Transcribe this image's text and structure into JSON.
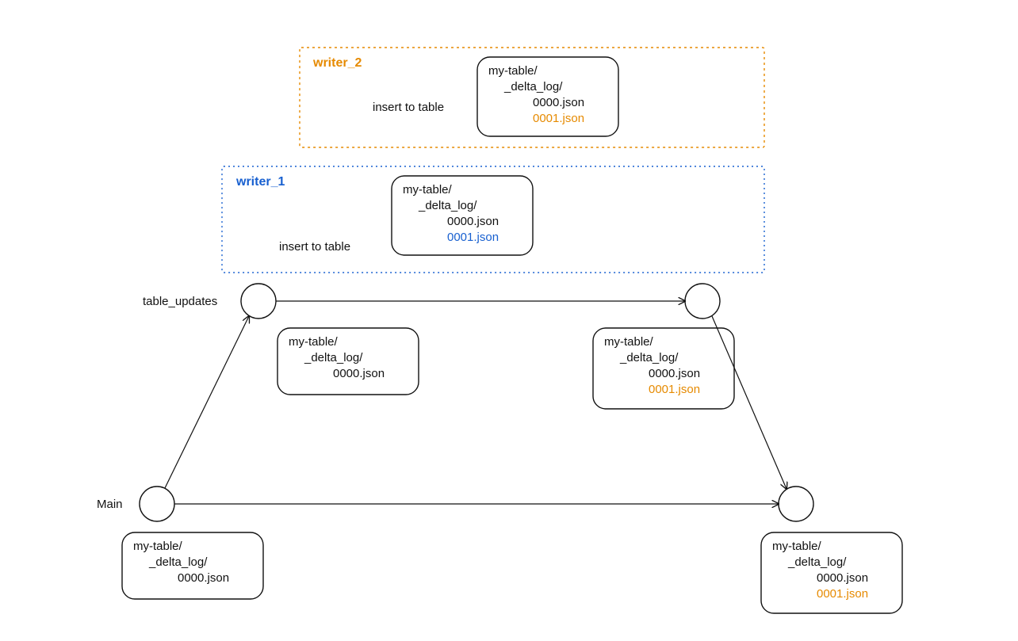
{
  "diagram": {
    "writer2": {
      "title": "writer_2",
      "action": "insert to table",
      "tree": {
        "root": "my-table/",
        "dir": "_delta_log/",
        "file0": "0000.json",
        "file1": "0001.json"
      }
    },
    "writer1": {
      "title": "writer_1",
      "action": "insert to table",
      "tree": {
        "root": "my-table/",
        "dir": "_delta_log/",
        "file0": "0000.json",
        "file1": "0001.json"
      }
    },
    "timeline": {
      "updates_label": "table_updates",
      "main_label": "Main",
      "state_left_updates": {
        "root": "my-table/",
        "dir": "_delta_log/",
        "file0": "0000.json"
      },
      "state_right_updates": {
        "root": "my-table/",
        "dir": "_delta_log/",
        "file0": "0000.json",
        "file1": "0001.json"
      },
      "state_left_main": {
        "root": "my-table/",
        "dir": "_delta_log/",
        "file0": "0000.json"
      },
      "state_right_main": {
        "root": "my-table/",
        "dir": "_delta_log/",
        "file0": "0000.json",
        "file1": "0001.json"
      }
    }
  }
}
